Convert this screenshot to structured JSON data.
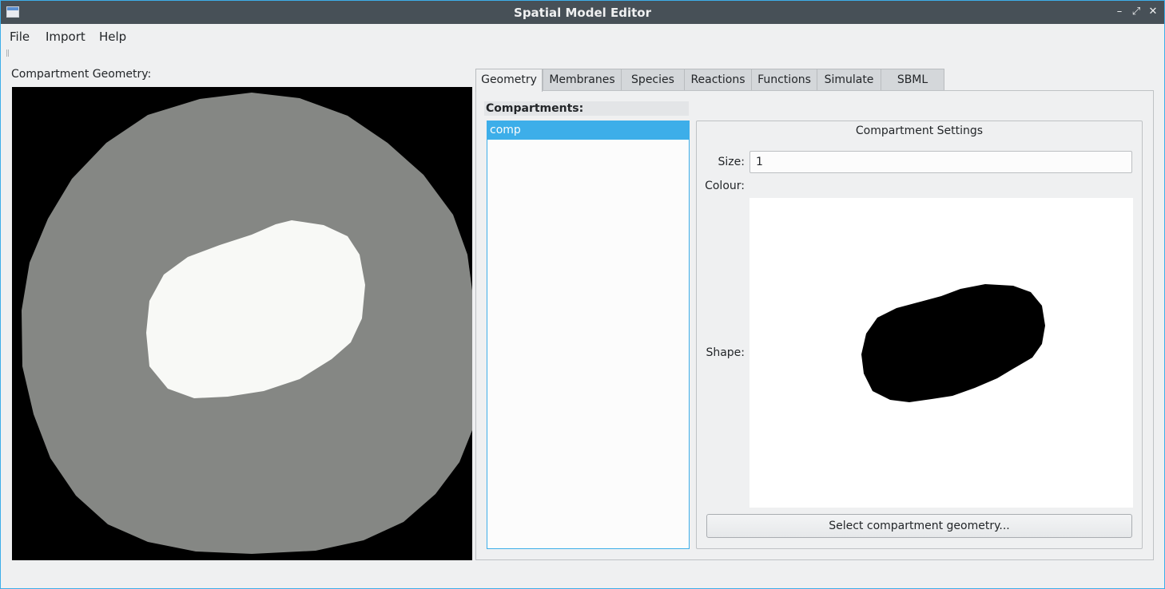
{
  "window": {
    "title": "Spatial Model Editor"
  },
  "menubar": {
    "items": [
      "File",
      "Import",
      "Help"
    ]
  },
  "geometry_panel": {
    "label": "Compartment Geometry:"
  },
  "tabs": [
    "Geometry",
    "Membranes",
    "Species",
    "Reactions",
    "Functions",
    "Simulate",
    "SBML"
  ],
  "active_tab": "Geometry",
  "compartments": {
    "header": "Compartments:",
    "items": [
      "comp"
    ],
    "selected": "comp"
  },
  "settings": {
    "title": "Compartment Settings",
    "size_label": "Size:",
    "size_value": "1",
    "colour_label": "Colour:",
    "shape_label": "Shape:",
    "select_button": "Select compartment geometry..."
  },
  "colors": {
    "accent": "#3daee9",
    "titlebar": "#475057",
    "outer_region": "#858784",
    "inner_region": "#f8f9f6",
    "background_region": "#000000"
  }
}
